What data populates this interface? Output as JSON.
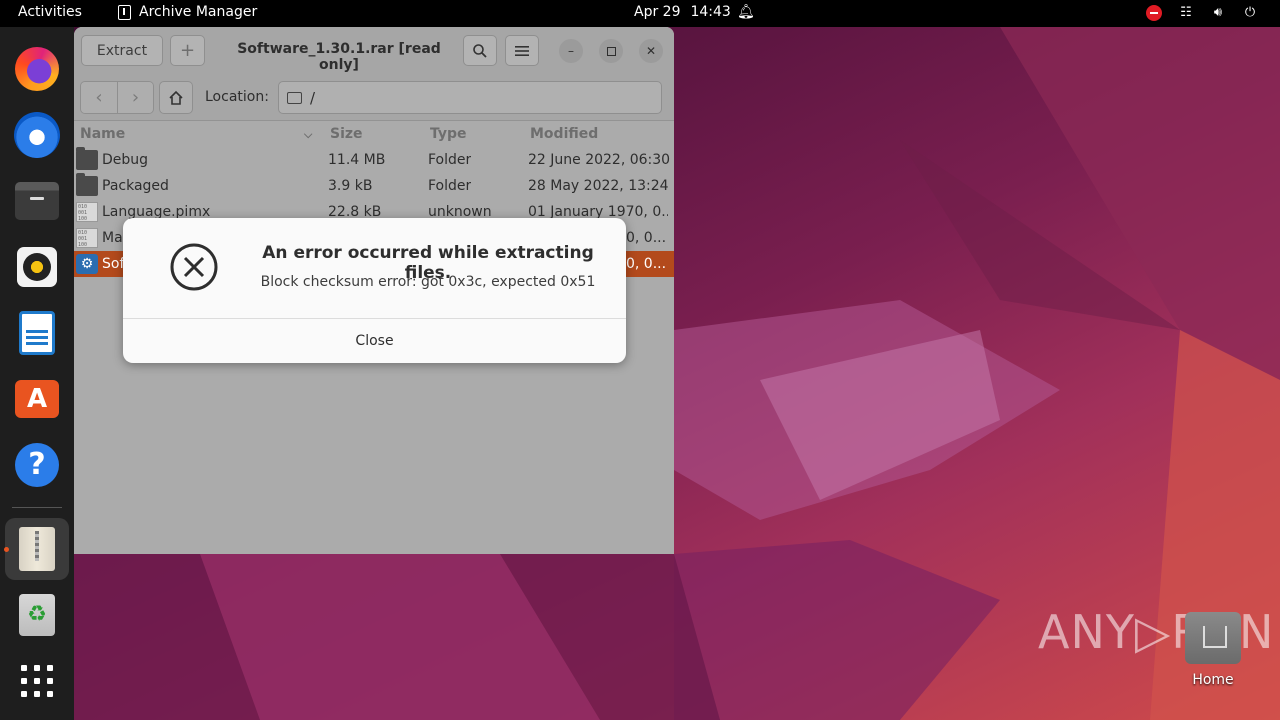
{
  "topbar": {
    "activities": "Activities",
    "app_name": "Archive Manager",
    "date": "Apr 29",
    "time": "14:43"
  },
  "dock": {
    "items": [
      "firefox-icon",
      "thunderbird-icon",
      "files-icon",
      "rhythmbox-icon",
      "writer-icon",
      "app-center-icon",
      "help-icon",
      "archive-manager-icon",
      "trash-icon",
      "show-apps-icon"
    ]
  },
  "window": {
    "title": "Software_1.30.1.rar [read only]",
    "extract_label": "Extract",
    "add_label": "+",
    "location_label": "Location:",
    "location_path": "/",
    "columns": [
      "Name",
      "Size",
      "Type",
      "Modified"
    ],
    "rows": [
      {
        "name": "Debug",
        "size": "11.4 MB",
        "type": "Folder",
        "modified": "22 June 2022, 06:30",
        "icon": "folder-icon"
      },
      {
        "name": "Packaged",
        "size": "3.9 kB",
        "type": "Folder",
        "modified": "28 May 2022, 13:24",
        "icon": "folder-icon"
      },
      {
        "name": "Language.pimx",
        "size": "22.8 kB",
        "type": "unknown",
        "modified": "01 January 1970, 0...",
        "icon": "binary-file-icon"
      },
      {
        "name": "Ma",
        "size": "",
        "type": "",
        "modified": "0, 0...",
        "icon": "binary-file-icon"
      },
      {
        "name": "Sof",
        "size": "",
        "type": "",
        "modified": "0, 0...",
        "icon": "executable-icon",
        "selected": true
      }
    ]
  },
  "dialog": {
    "title": "An error occurred while extracting files.",
    "message": "Block checksum error: got 0x3c, expected 0x51",
    "close_label": "Close"
  },
  "desktop": {
    "home_label": "Home",
    "watermark": "ANY▷RUN"
  }
}
